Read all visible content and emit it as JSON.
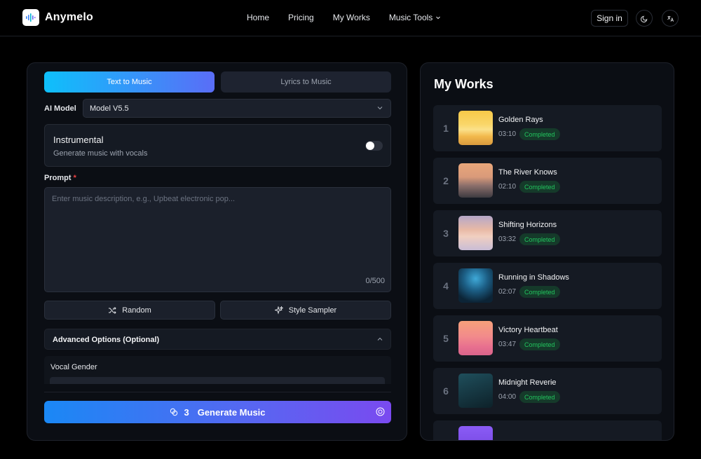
{
  "brand": {
    "name": "Anymelo"
  },
  "nav": {
    "links": [
      "Home",
      "Pricing",
      "My Works",
      "Music Tools"
    ],
    "signin": "Sign in"
  },
  "composer": {
    "tabs": {
      "active": "Text to Music",
      "other": "Lyrics to Music"
    },
    "model_label": "AI Model",
    "model_value": "Model V5.5",
    "instrumental_title": "Instrumental",
    "instrumental_sub": "Generate music with vocals",
    "prompt_label": "Prompt",
    "prompt_required": "*",
    "prompt_placeholder": "Enter music description, e.g., Upbeat electronic pop...",
    "prompt_counter": "0/500",
    "random_label": "Random",
    "sampler_label": "Style Sampler",
    "advanced_label": "Advanced Options (Optional)",
    "vocal_gender_label": "Vocal Gender",
    "generate_credits": "3",
    "generate_label": "Generate Music"
  },
  "works": {
    "title": "My Works",
    "items": [
      {
        "num": "1",
        "title": "Golden Rays",
        "duration": "03:10",
        "status": "Completed"
      },
      {
        "num": "2",
        "title": "The River Knows",
        "duration": "02:10",
        "status": "Completed"
      },
      {
        "num": "3",
        "title": "Shifting Horizons",
        "duration": "03:32",
        "status": "Completed"
      },
      {
        "num": "4",
        "title": "Running in Shadows",
        "duration": "02:07",
        "status": "Completed"
      },
      {
        "num": "5",
        "title": "Victory Heartbeat",
        "duration": "03:47",
        "status": "Completed"
      },
      {
        "num": "6",
        "title": "Midnight Reverie",
        "duration": "04:00",
        "status": "Completed"
      }
    ]
  },
  "colors": {
    "accent_start": "#0ec0fb",
    "accent_end": "#7a4af0",
    "status_green": "#22c55e"
  }
}
